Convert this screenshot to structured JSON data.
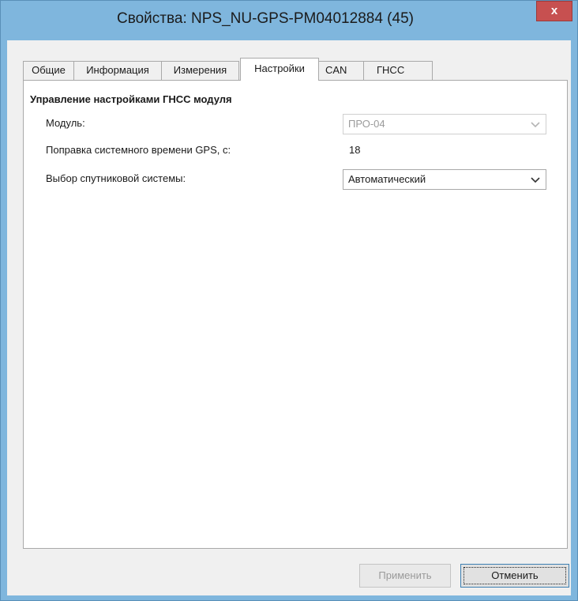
{
  "window": {
    "title": "Свойства: NPS_NU-GPS-PM04012884 (45)",
    "close_label": "x"
  },
  "tabs": [
    {
      "label": "Общие",
      "active": false
    },
    {
      "label": "Информация",
      "active": false
    },
    {
      "label": "Измерения",
      "active": false
    },
    {
      "label": "Настройки",
      "active": true
    },
    {
      "label": "CAN",
      "active": false
    },
    {
      "label": "ГНСС",
      "active": false
    }
  ],
  "settings": {
    "group_title": "Управление настройками ГНСС модуля",
    "module": {
      "label": "Модуль:",
      "value": "ПРО-04",
      "enabled": false
    },
    "gps_correction": {
      "label": "Поправка системного времени GPS, с:",
      "value": "18"
    },
    "satellite_system": {
      "label": "Выбор спутниковой системы:",
      "value": "Автоматический",
      "enabled": true
    }
  },
  "buttons": {
    "apply": "Применить",
    "cancel": "Отменить"
  },
  "colors": {
    "title_bar": "#7fb6dd",
    "close_button": "#c75050",
    "client_bg": "#f0f0f0"
  },
  "icons": {
    "combo_arrow": "chevron-down-icon"
  }
}
